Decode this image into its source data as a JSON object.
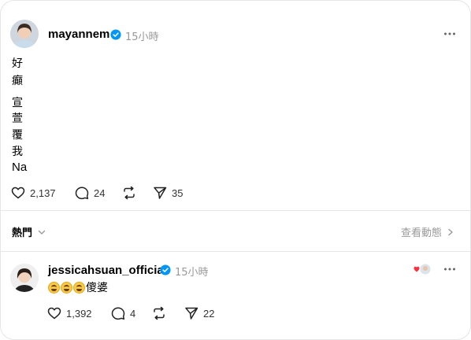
{
  "post": {
    "username": "mayannem",
    "timestamp": "15小時",
    "body_lines": [
      "好",
      "癲",
      "宣",
      "萱",
      "覆",
      "我",
      "Na"
    ],
    "likes": "2,137",
    "comments": "24",
    "shares": "35"
  },
  "sort": {
    "label": "熱門",
    "activity_label": "查看動態"
  },
  "reply": {
    "username": "jessicahsuan_official",
    "timestamp": "15小時",
    "emoji_count": 3,
    "text": "傻婆",
    "likes": "1,392",
    "comments": "4",
    "shares": "22"
  },
  "colors": {
    "verified": "#0095f6",
    "secondary_text": "#999999",
    "divider": "#e6e6e6",
    "heart_red": "#ff3040"
  },
  "icons": [
    "heart-icon",
    "comment-icon",
    "repost-icon",
    "send-icon",
    "more-icon",
    "verified-icon",
    "chevron-down-icon",
    "chevron-right-icon"
  ]
}
